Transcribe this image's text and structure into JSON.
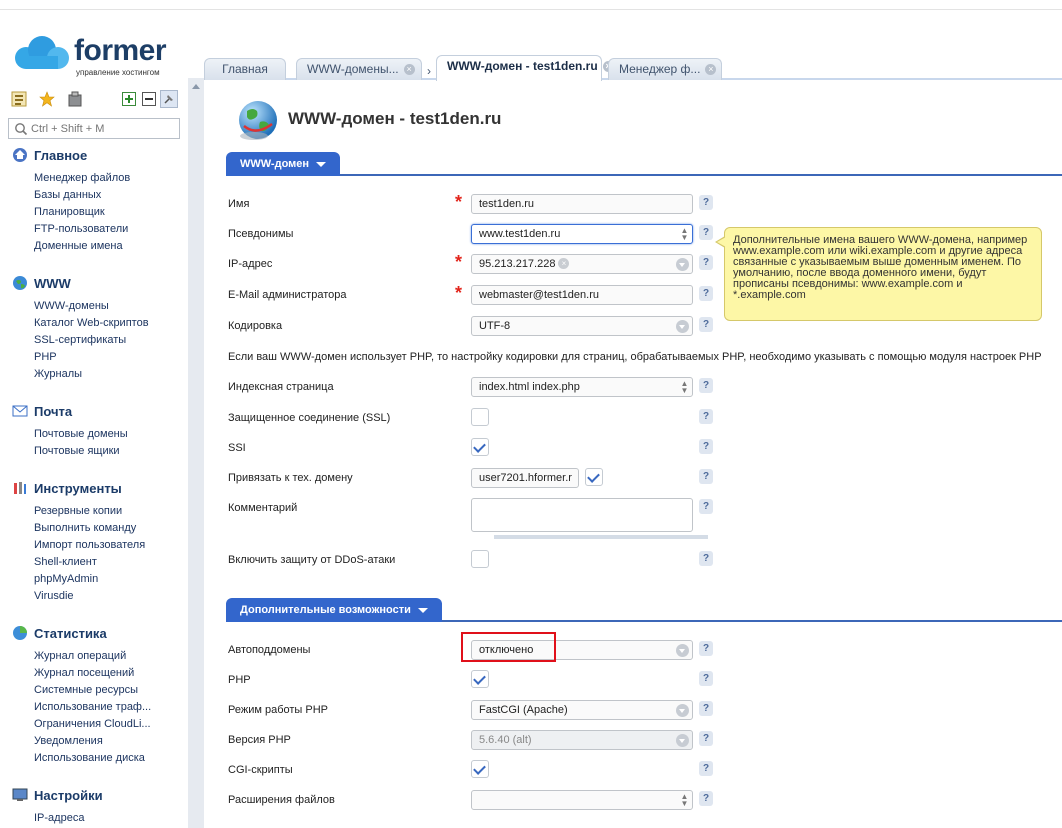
{
  "brand": {
    "name": "former",
    "tagline": "управление хостингом"
  },
  "search": {
    "placeholder": "Ctrl + Shift + M"
  },
  "sidebar": {
    "groups": [
      {
        "title": "Главное",
        "icon": "home-icon",
        "items": [
          "Менеджер файлов",
          "Базы данных",
          "Планировщик",
          "FTP-пользователи",
          "Доменные имена"
        ]
      },
      {
        "title": "WWW",
        "icon": "www-globe-icon",
        "items": [
          "WWW-домены",
          "Каталог Web-скриптов",
          "SSL-сертификаты",
          "PHP",
          "Журналы"
        ]
      },
      {
        "title": "Почта",
        "icon": "mail-icon",
        "items": [
          "Почтовые домены",
          "Почтовые ящики"
        ]
      },
      {
        "title": "Инструменты",
        "icon": "tools-icon",
        "items": [
          "Резервные копии",
          "Выполнить команду",
          "Импорт пользователя",
          "Shell-клиент",
          "phpMyAdmin",
          "Virusdie"
        ]
      },
      {
        "title": "Статистика",
        "icon": "stats-icon",
        "items": [
          "Журнал операций",
          "Журнал посещений",
          "Системные ресурсы",
          "Использование траф...",
          "Ограничения CloudLi...",
          "Уведомления",
          "Использование диска"
        ]
      },
      {
        "title": "Настройки",
        "icon": "settings-icon",
        "items": [
          "IP-адреса"
        ]
      }
    ]
  },
  "tabs": [
    {
      "label": "Главная",
      "active": false,
      "closable": false
    },
    {
      "label": "WWW-домены...",
      "active": false,
      "closable": true
    },
    {
      "label": "WWW-домен - test1den.ru",
      "active": true,
      "closable": true
    },
    {
      "label": "Менеджер ф...",
      "active": false,
      "closable": true
    }
  ],
  "page": {
    "title": "WWW-домен - test1den.ru"
  },
  "sections": {
    "main": "WWW-домен",
    "extra": "Дополнительные возможности"
  },
  "form": {
    "name": {
      "label": "Имя",
      "value": "test1den.ru"
    },
    "aliases": {
      "label": "Псевдонимы",
      "value": "www.test1den.ru"
    },
    "ip": {
      "label": "IP-адрес",
      "value": "95.213.217.228"
    },
    "email": {
      "label": "E-Mail администратора",
      "value": "webmaster@test1den.ru"
    },
    "encoding": {
      "label": "Кодировка",
      "value": "UTF-8"
    },
    "encoding_note": "Если ваш WWW-домен использует PHP, то настройку кодировки для страниц, обрабатываемых PHP, необходимо указывать с помощью модуля настроек PHP",
    "index": {
      "label": "Индексная страница",
      "value": "index.html index.php"
    },
    "ssl": {
      "label": "Защищенное соединение (SSL)",
      "checked": false
    },
    "ssi": {
      "label": "SSI",
      "checked": true
    },
    "techdomain": {
      "label": "Привязать к тех. домену",
      "value": "user7201.hformer.r",
      "checked": true
    },
    "comment": {
      "label": "Комментарий",
      "value": ""
    },
    "ddos": {
      "label": "Включить защиту от DDoS-атаки",
      "checked": false
    },
    "autosub": {
      "label": "Автоподдомены",
      "value": "отключено"
    },
    "php": {
      "label": "PHP",
      "checked": true
    },
    "phpmode": {
      "label": "Режим работы PHP",
      "value": "FastCGI (Apache)"
    },
    "phpver": {
      "label": "Версия PHP",
      "value": "5.6.40 (alt)"
    },
    "cgi": {
      "label": "CGI-скрипты",
      "checked": true
    },
    "ext": {
      "label": "Расширения файлов",
      "value": ""
    }
  },
  "tooltip": "Дополнительные имена вашего WWW-домена, например www.example.com или wiki.example.com и другие адреса связанные с указываемым выше доменным именем. По умолчанию, после ввода доменного имени, будут прописаны псевдонимы: www.example.com и *.example.com",
  "help_glyph": "?",
  "colors": {
    "accent": "#3366cc",
    "required": "#e2241b",
    "highlight": "#e0101a",
    "tooltip_bg": "#fdf7a6"
  }
}
